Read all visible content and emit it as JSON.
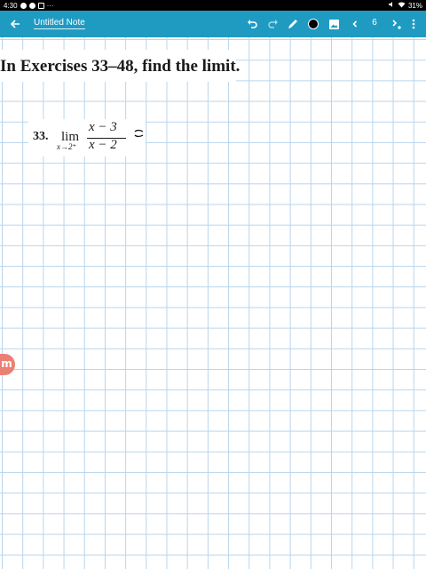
{
  "status_bar": {
    "time": "4:30",
    "extra": "···",
    "battery": "31%"
  },
  "toolbar": {
    "title": "Untitled Note",
    "page_number": "6",
    "accent_color": "#1f9bc2",
    "pen_color": "#000000",
    "icons": [
      "back-arrow-icon",
      "undo-icon",
      "redo-icon",
      "pen-icon",
      "color-dot-icon",
      "image-icon",
      "chevron-left-icon",
      "chevron-right-add-icon",
      "more-vert-icon"
    ]
  },
  "note": {
    "heading": "In Exercises 33–48, find the limit.",
    "exercise": {
      "number": "33.",
      "lim": "lim",
      "subscript": "x→2⁺",
      "numerator": "x − 3",
      "denominator": "x − 2"
    },
    "grid_color": "#b9d5ec"
  },
  "side_badge": {
    "letter": "m",
    "color": "#ec7f73"
  }
}
